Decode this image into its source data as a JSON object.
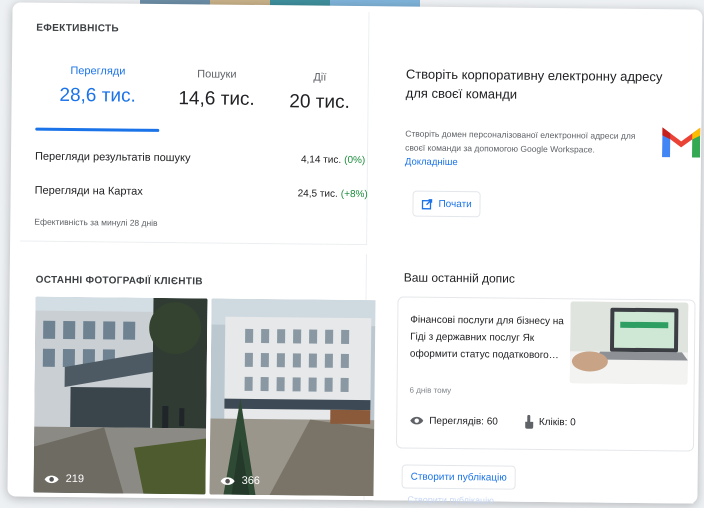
{
  "performance": {
    "title": "ЕФЕКТИВНІСТЬ",
    "tabs": [
      {
        "label": "Перегляди",
        "value": "28,6 тис."
      },
      {
        "label": "Пошуки",
        "value": "14,6 тис."
      },
      {
        "label": "Дії",
        "value": "20 тис."
      }
    ],
    "rows": [
      {
        "label": "Перегляди результатів пошуку",
        "value": "4,14 тис.",
        "change": "(0%)"
      },
      {
        "label": "Перегляди на Картах",
        "value": "24,5 тис.",
        "change": "(+8%)"
      }
    ],
    "footnote": "Ефективність за минулі 28 днів"
  },
  "promo": {
    "title": "Створіть корпоративну електронну адресу для своєї команди",
    "text": "Створіть домен персоналізованої електронної адреси для своєї команди за допомогою Google Workspace.",
    "link": "Докладніше",
    "button": "Почати"
  },
  "photos": {
    "title": "ОСТАННІ ФОТОГРАФІЇ КЛІЄНТІВ",
    "items": [
      {
        "views": "219"
      },
      {
        "views": "366"
      }
    ]
  },
  "post": {
    "title": "Ваш останній допис",
    "headline": "Фінансові послуги для бізнесу на Гіді з державних послуг Як оформити статус податкового…",
    "date": "6 днів тому",
    "views": "Переглядів: 60",
    "clicks": "Кліків: 0",
    "create_button": "Створити публікацію",
    "ghost_text": "Створити публікацію"
  }
}
